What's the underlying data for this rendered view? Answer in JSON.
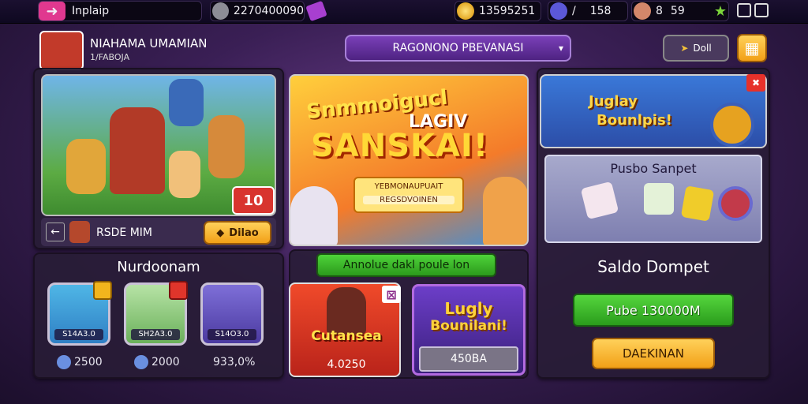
{
  "topbar": {
    "back_label": "Inplaip",
    "id_value": "2270400090",
    "coins": "13595251",
    "gems": "158",
    "lives": "59"
  },
  "profile": {
    "name": "NIAHAMA UMAMIAN",
    "level": "1/FABOJA"
  },
  "region_select": "RAGONONO PBEVANASI",
  "share_label": "Doll",
  "hero": {
    "badge": "10",
    "name": "RSDE MIM",
    "button": "Dilao"
  },
  "promo": {
    "title_line1": "Snmmoigucl",
    "title_line2": "SANSKAI!",
    "sub_title": "LAGIV",
    "tag_line1": "YEBMONAUPUAIT",
    "tag_line2": "REGSDVOINEN"
  },
  "section2_title": "Nurdoonam",
  "items": [
    {
      "tag": "S14A3.0",
      "value": "2500"
    },
    {
      "tag": "SH2A3.0",
      "value": "2000"
    },
    {
      "tag": "S14O3.0",
      "value": "933,0%"
    }
  ],
  "green_label": "Annolue dakl poule lon",
  "card_left": {
    "title": "Cutansea",
    "value": "4.0250"
  },
  "card_right": {
    "title_line1": "Lugly",
    "title_line2": "Bounilani!",
    "value": "450BA"
  },
  "right_panel": {
    "banner_line1": "Juglay",
    "banner_line2": "Bounlpis!",
    "pusbo": "Pusbo Sanpet",
    "saldo": "Saldo Dompet",
    "btn_green": "Pube 130000M",
    "btn_orange": "DAEKINAN"
  },
  "colors": {
    "accent": "#f2a017",
    "green": "#34b424",
    "purple": "#6b2fa3"
  }
}
